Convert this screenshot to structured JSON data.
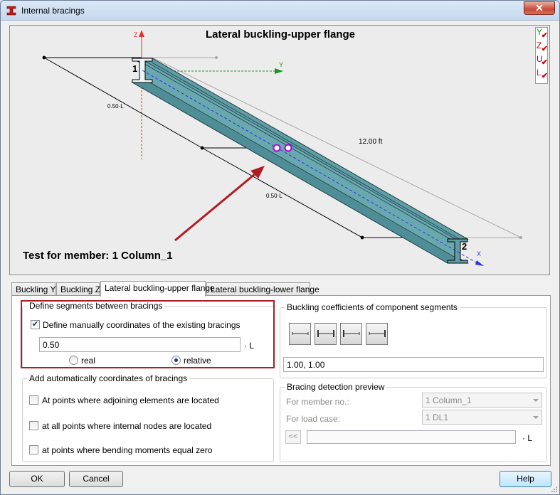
{
  "window": {
    "title": "Internal bracings",
    "close_label": "✕"
  },
  "canvas": {
    "title": "Lateral buckling-upper flange",
    "member_text": "Test for member: 1 Column_1",
    "length_label": "12.00  ft",
    "dim_label_upper": "0.50·L",
    "dim_label_lower": "0.50·L",
    "node_start": "1",
    "node_end": "2",
    "axis_z": "Z",
    "axis_y": "Y",
    "axis_x": "X",
    "legend": [
      {
        "letter": "Y",
        "color": "#00a000"
      },
      {
        "letter": "Z",
        "color": "#d40000"
      },
      {
        "letter": "U",
        "color": "#7000a0"
      },
      {
        "letter": "L",
        "color": "#c000c0"
      }
    ],
    "beam_color": "#5f9ea6",
    "arrow_color": "#b01c22"
  },
  "tabs": [
    {
      "label": "Buckling Y"
    },
    {
      "label": "Buckling Z"
    },
    {
      "label": "Lateral buckling-upper flange"
    },
    {
      "label": "Lateral buckling-lower flange"
    }
  ],
  "define": {
    "group_label": "Define segments between bracings",
    "manual_label": "Define manually coordinates of the existing bracings",
    "manual_checked": true,
    "value": "0.50",
    "unit": "· L",
    "radio_real": "real",
    "radio_relative": "relative",
    "selected": "relative"
  },
  "auto": {
    "group_label": "Add automatically coordinates of bracings",
    "options": [
      {
        "label": "At points where adjoining elements are located",
        "checked": false
      },
      {
        "label": "at all points where internal nodes are located",
        "checked": false
      },
      {
        "label": "at points where bending moments equal zero",
        "checked": false
      }
    ]
  },
  "coefficients": {
    "group_label": "Buckling coefficients of component segments",
    "value": "1.00, 1.00"
  },
  "preview": {
    "group_label": "Bracing detection preview",
    "member_label": "For member no.:",
    "member_value": "1 Column_1",
    "loadcase_label": "For load case:",
    "loadcase_value": "1  DL1",
    "back_button": "<<",
    "unit": "· L"
  },
  "buttons": {
    "ok": "OK",
    "cancel": "Cancel",
    "help": "Help"
  }
}
